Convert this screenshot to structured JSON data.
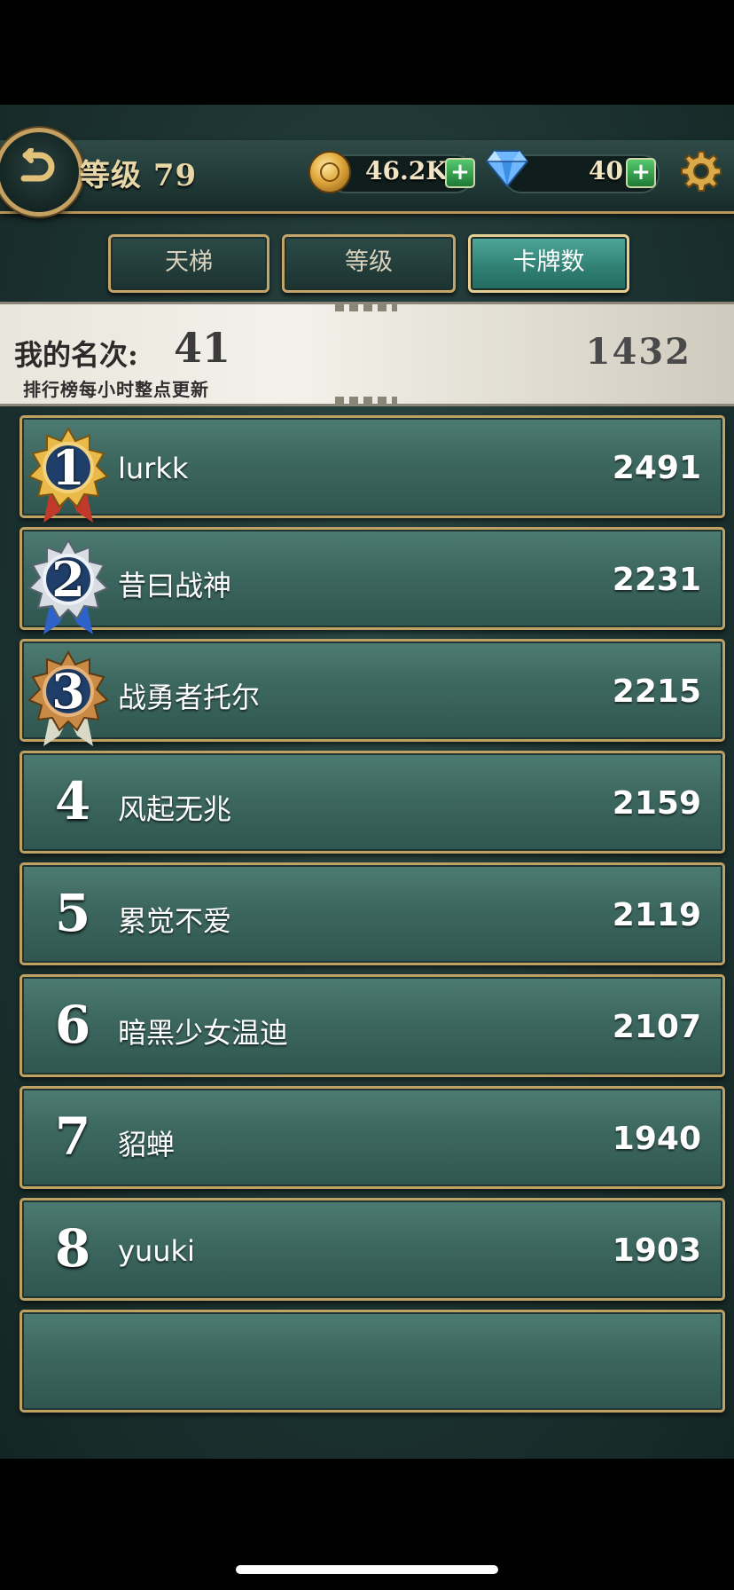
{
  "header": {
    "level_label": "等级 79",
    "gold": "46.2K",
    "gems": "40",
    "plus_label": "+"
  },
  "tabs": [
    {
      "label": "天梯",
      "active": false
    },
    {
      "label": "等级",
      "active": false
    },
    {
      "label": "卡牌数",
      "active": true
    }
  ],
  "my_rank": {
    "label": "我的名次:",
    "value": "41",
    "score": "1432",
    "note": "排行榜每小时整点更新"
  },
  "leaderboard": [
    {
      "rank": "1",
      "name": "lurkk",
      "score": "2491",
      "medal": "gold"
    },
    {
      "rank": "2",
      "name": "昔曰战神",
      "score": "2231",
      "medal": "silver"
    },
    {
      "rank": "3",
      "name": "战勇者托尔",
      "score": "2215",
      "medal": "bronze"
    },
    {
      "rank": "4",
      "name": "风起无兆",
      "score": "2159"
    },
    {
      "rank": "5",
      "name": "累觉不爱",
      "score": "2119"
    },
    {
      "rank": "6",
      "name": "暗黑少女温迪",
      "score": "2107"
    },
    {
      "rank": "7",
      "name": "貂蝉",
      "score": "1940"
    },
    {
      "rank": "8",
      "name": "yuuki",
      "score": "1903"
    }
  ],
  "colors": {
    "accent_gold": "#c3a46a",
    "row_green": "#3c675f",
    "tab_active": "#2f7f72"
  },
  "icons": [
    "back-arrow-icon",
    "gold-coin-icon",
    "diamond-icon",
    "gear-icon",
    "gold-medal-icon",
    "silver-medal-icon",
    "bronze-medal-icon"
  ]
}
